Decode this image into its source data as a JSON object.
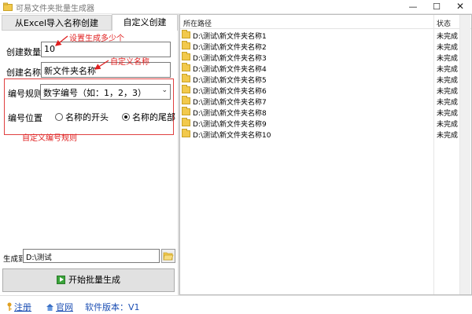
{
  "window": {
    "title": "可易文件夹批量生成器",
    "minimize": "—",
    "maximize": "☐",
    "close": "✕"
  },
  "tabs": [
    {
      "label": "从Excel导入名称创建",
      "active": false
    },
    {
      "label": "自定义创建",
      "active": true
    }
  ],
  "form": {
    "count_label": "创建数量",
    "count_value": "10",
    "name_label": "创建名称",
    "name_value": "新文件夹名称",
    "rule_label": "编号规则",
    "rule_value": "数字编号（如：1，2，3）",
    "position_label": "编号位置",
    "position_options": [
      {
        "label": "名称的开头",
        "checked": false
      },
      {
        "label": "名称的尾部",
        "checked": true
      }
    ]
  },
  "annotations": {
    "count": "设置生成多少个",
    "name": "自定义名称",
    "rule": "自定义编号规则"
  },
  "output": {
    "label": "生成到",
    "path": "D:\\测试"
  },
  "start_button": "开始批量生成",
  "list": {
    "headers": {
      "path": "所在路径",
      "status": "状态"
    },
    "rows": [
      {
        "path": "D:\\测试\\新文件夹名称1",
        "status": "未完成"
      },
      {
        "path": "D:\\测试\\新文件夹名称2",
        "status": "未完成"
      },
      {
        "path": "D:\\测试\\新文件夹名称3",
        "status": "未完成"
      },
      {
        "path": "D:\\测试\\新文件夹名称4",
        "status": "未完成"
      },
      {
        "path": "D:\\测试\\新文件夹名称5",
        "status": "未完成"
      },
      {
        "path": "D:\\测试\\新文件夹名称6",
        "status": "未完成"
      },
      {
        "path": "D:\\测试\\新文件夹名称7",
        "status": "未完成"
      },
      {
        "path": "D:\\测试\\新文件夹名称8",
        "status": "未完成"
      },
      {
        "path": "D:\\测试\\新文件夹名称9",
        "status": "未完成"
      },
      {
        "path": "D:\\测试\\新文件夹名称10",
        "status": "未完成"
      }
    ]
  },
  "statusbar": {
    "register": "注册",
    "website": "官网",
    "version": "软件版本：V1"
  },
  "colors": {
    "annotation": "#e02020",
    "link": "#1a4db3",
    "folder": "#f2c94c",
    "start_icon": "#3aa43a"
  }
}
